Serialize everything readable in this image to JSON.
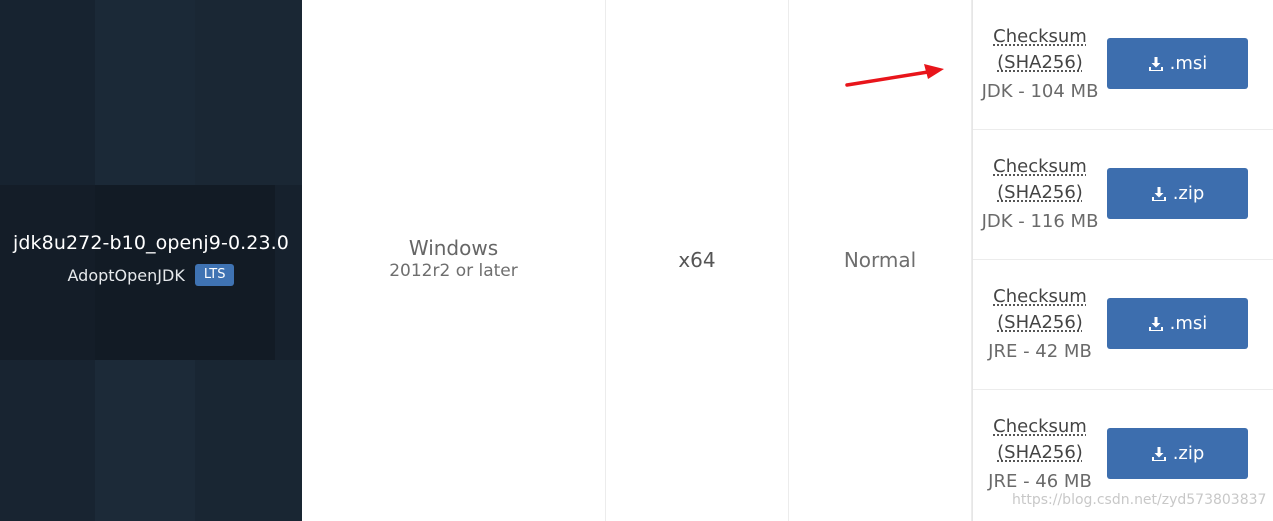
{
  "release": {
    "name": "jdk8u272-b10_openj9-0.23.0",
    "vendor": "AdoptOpenJDK",
    "badge": "LTS"
  },
  "os": {
    "name": "Windows",
    "version": "2012r2 or later"
  },
  "architecture": "x64",
  "heap_size": "Normal",
  "downloads": [
    {
      "checksum_line1": "Checksum",
      "checksum_line2": "(SHA256)",
      "size": "JDK - 104 MB",
      "button_label": ".msi"
    },
    {
      "checksum_line1": "Checksum",
      "checksum_line2": "(SHA256)",
      "size": "JDK - 116 MB",
      "button_label": ".zip"
    },
    {
      "checksum_line1": "Checksum",
      "checksum_line2": "(SHA256)",
      "size": "JRE - 42 MB",
      "button_label": ".msi"
    },
    {
      "checksum_line1": "Checksum",
      "checksum_line2": "(SHA256)",
      "size": "JRE - 46 MB",
      "button_label": ".zip"
    }
  ],
  "icons": {
    "download": "download-icon",
    "annotation": "red-arrow"
  },
  "colors": {
    "release_bg": "#16202c",
    "button_bg": "#3d6eae",
    "badge_bg": "#3f73b3",
    "arrow": "#e8151b"
  },
  "watermark": "https://blog.csdn.net/zyd573803837"
}
